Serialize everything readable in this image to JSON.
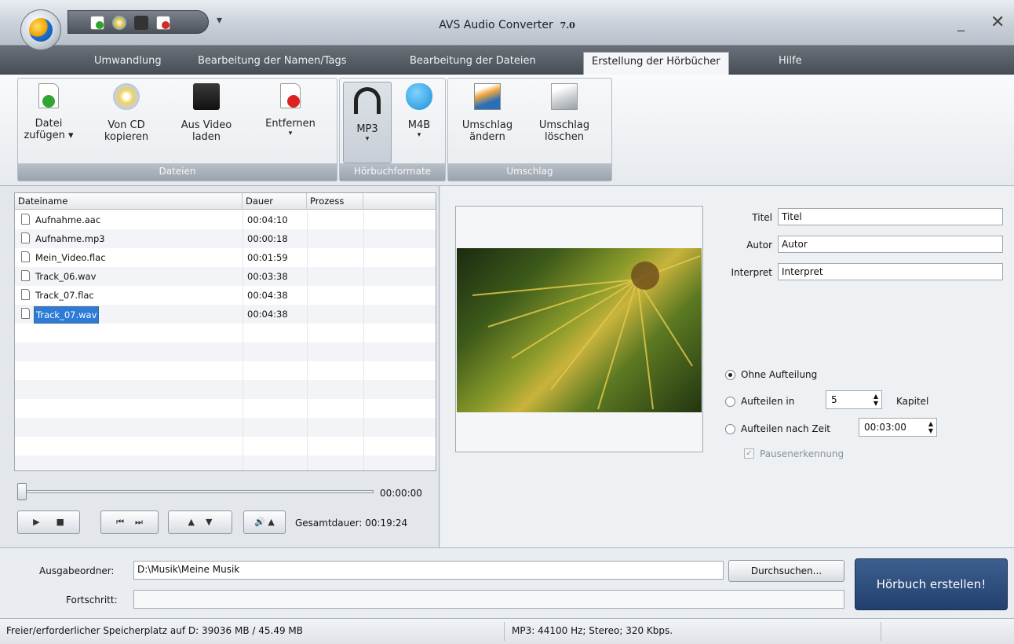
{
  "window": {
    "title": "AVS Audio Converter",
    "version": "7.0",
    "minimize": "_",
    "close": "✕"
  },
  "qat": {
    "dropdown": "▾"
  },
  "tabs": [
    "Umwandlung",
    "Bearbeitung der Namen/Tags",
    "Bearbeitung der Dateien",
    "Erstellung der Hörbücher",
    "Hilfe"
  ],
  "active_tab": "Erstellung der Hörbücher",
  "ribbon": {
    "groups": {
      "dateien": "Dateien",
      "formate": "Hörbuchformate",
      "umschlag": "Umschlag"
    },
    "buttons": {
      "add_file": {
        "l1": "Datei",
        "l2": "zufügen ▾"
      },
      "from_cd": {
        "l1": "Von CD",
        "l2": "kopieren"
      },
      "from_video": {
        "l1": "Aus Video",
        "l2": "laden"
      },
      "remove": {
        "l1": "Entfernen",
        "l2": "▾"
      },
      "mp3": {
        "l1": "MP3",
        "l2": "▾"
      },
      "m4b": {
        "l1": "M4B",
        "l2": "▾"
      },
      "change_cover": {
        "l1": "Umschlag",
        "l2": "ändern"
      },
      "delete_cover": {
        "l1": "Umschlag",
        "l2": "löschen"
      }
    }
  },
  "filelist": {
    "columns": [
      "Dateiname",
      "Dauer",
      "Prozess"
    ],
    "rows": [
      {
        "name": "Aufnahme.aac",
        "duration": "00:04:10"
      },
      {
        "name": "Aufnahme.mp3",
        "duration": "00:00:18"
      },
      {
        "name": "Mein_Video.flac",
        "duration": "00:01:59"
      },
      {
        "name": "Track_06.wav",
        "duration": "00:03:38"
      },
      {
        "name": "Track_07.flac",
        "duration": "00:04:38"
      },
      {
        "name": "Track_07.wav",
        "duration": "00:04:38"
      }
    ],
    "selected_index": 5
  },
  "player": {
    "current_time": "00:00:00",
    "position": 0,
    "total_label": "Gesamtdauer:",
    "total": "00:19:24",
    "buttons": {
      "play": "▶",
      "stop": "■",
      "prev": "⏮",
      "next": "⏭",
      "up": "▲",
      "down": "▼",
      "volume": "🔊",
      "vol_arrow": "▲"
    }
  },
  "meta": {
    "title_label": "Titel",
    "title_value": "Titel",
    "author_label": "Autor",
    "author_value": "Autor",
    "performer_label": "Interpret",
    "performer_value": "Interpret"
  },
  "split": {
    "none": "Ohne Aufteilung",
    "into": "Aufteilen in",
    "into_value": "5",
    "chapters": "Kapitel",
    "by_time": "Aufteilen nach Zeit",
    "time_value": "00:03:00",
    "pause": "Pausenerkennung",
    "selected": "none"
  },
  "bottom": {
    "output_label": "Ausgabeordner:",
    "output_value": "D:\\Musik\\Meine Musik",
    "browse": "Durchsuchen...",
    "progress_label": "Fortschritt:",
    "create": "Hörbuch erstellen!"
  },
  "status": {
    "space": "Freier/erforderlicher Speicherplatz auf D: 39036 MB / 45.49 MB",
    "format": "MP3: 44100  Hz; Stereo; 320 Kbps."
  }
}
